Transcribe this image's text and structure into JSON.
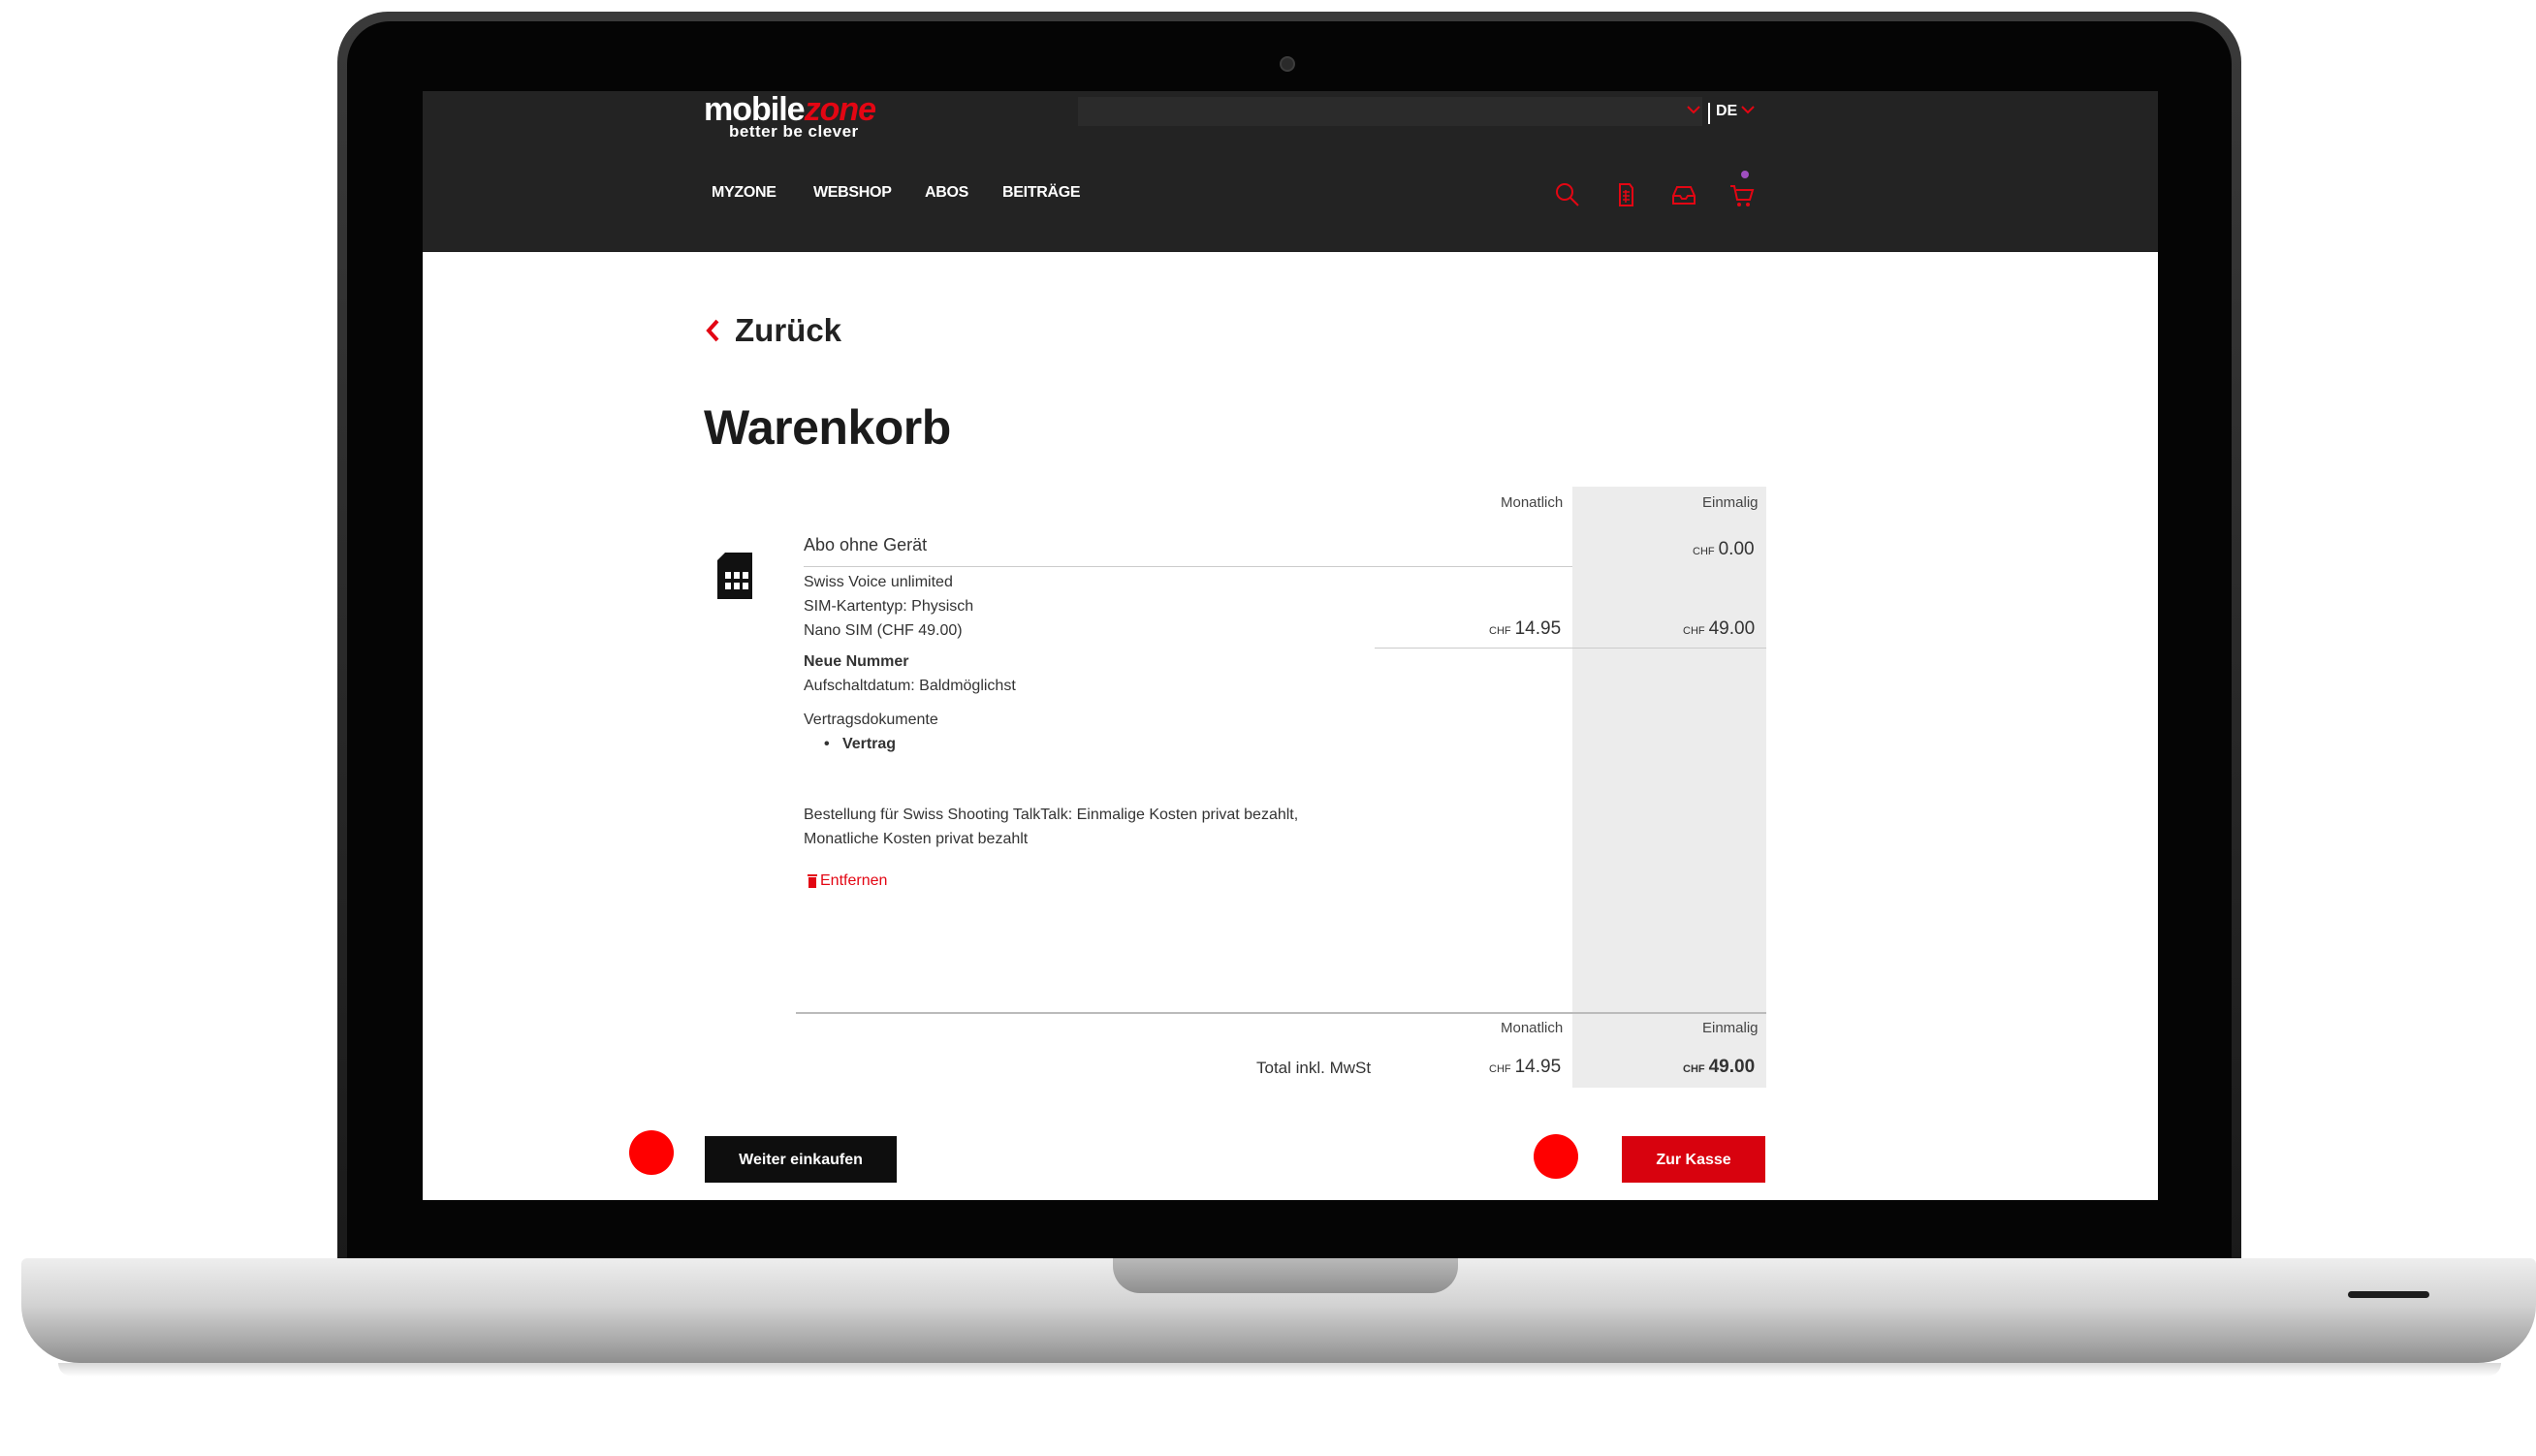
{
  "header": {
    "logo_main_a": "mobile",
    "logo_main_b": "zone",
    "logo_sub": "better be clever",
    "language": "DE",
    "nav": [
      {
        "label": "MYZONE"
      },
      {
        "label": "WEBSHOP"
      },
      {
        "label": "ABOS"
      },
      {
        "label": "BEITRÄGE"
      }
    ],
    "icons": [
      "search-icon",
      "sim-card-icon",
      "inbox-icon",
      "cart-icon"
    ]
  },
  "page": {
    "back_label": "Zurück",
    "title": "Warenkorb"
  },
  "cart": {
    "col_monthly": "Monatlich",
    "col_once": "Einmalig",
    "item_title": "Abo ohne Gerät",
    "item_once_price": "0.00",
    "currency": "CHF",
    "details": [
      "Swiss Voice unlimited",
      "SIM-Kartentyp: Physisch",
      "Nano SIM (CHF 49.00)"
    ],
    "detail_monthly": "14.95",
    "detail_once": "49.00",
    "number_heading": "Neue Nummer",
    "activation": "Aufschaltdatum: Baldmöglichst",
    "docs_heading": "Vertragsdokumente",
    "docs": [
      "Vertrag"
    ],
    "order_note_1": "Bestellung für Swiss Shooting TalkTalk: Einmalige Kosten privat bezahlt,",
    "order_note_2": "Monatliche Kosten privat bezahlt",
    "remove_label": "Entfernen",
    "total_label": "Total inkl. MwSt",
    "total_monthly": "14.95",
    "total_once": "49.00"
  },
  "actions": {
    "continue_label": "Weiter einkaufen",
    "checkout_label": "Zur Kasse"
  },
  "colors": {
    "accent": "#e30613",
    "header_bg": "#232323",
    "price_col_bg": "#ececec"
  }
}
